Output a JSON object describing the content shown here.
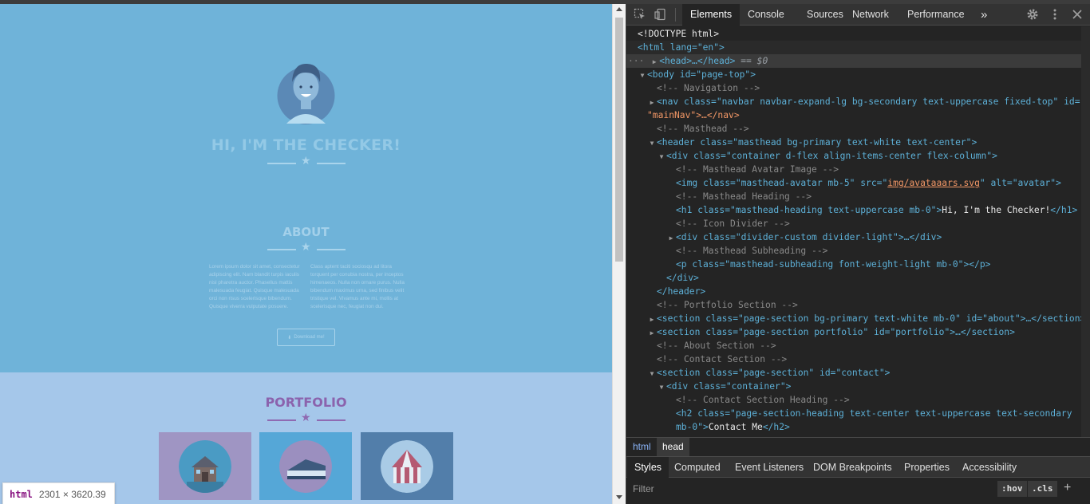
{
  "page": {
    "masthead": {
      "title": "HI, I'M THE CHECKER!"
    },
    "about": {
      "title": "ABOUT",
      "col1": "Lorem ipsum dolor sit amet, consectetur adipiscing elit. Nam blandit turpis iaculis nisl pharetra auctor. Phasellus mattis malesuada feugiat. Quisque malesuada orci non risus scelerisque bibendum. Quisque viverra vulputate posuere.",
      "col2": "Class aptent taciti sociosqu ad litora torquent per conubia nostra, per inceptos himenaeos. Nulla non ornare purus. Nulla bibendum maximus urna, sed finibus velit tristique vel. Vivamus ante mi, mollis at scelerisque nec, feugiat non dui.",
      "download_label": "Download me!"
    },
    "portfolio": {
      "title": "PORTFOLIO"
    },
    "inspect_badge": {
      "tag": "html",
      "dims": "2301 × 3620.39"
    }
  },
  "devtools": {
    "tabs": [
      "Elements",
      "Console",
      "Sources",
      "Network",
      "Performance"
    ],
    "more": "»",
    "elements": {
      "doctype": "<!DOCTYPE html>",
      "html_tag": "<html lang=\"en\">",
      "head": "<head>…</head>",
      "sel_marker": "== $0",
      "body": "<body id=\"page-top\">",
      "c_nav": "<!-- Navigation -->",
      "nav_tag": "<nav class=\"navbar navbar-expand-lg bg-secondary text-uppercase fixed-top\" id=",
      "nav_tag2": "\"mainNav\">…</nav>",
      "c_masthead": "<!-- Masthead -->",
      "header_tag": "<header class=\"masthead bg-primary text-white text-center\">",
      "div_container": "<div class=\"container d-flex align-items-center flex-column\">",
      "c_avatar": "<!-- Masthead Avatar Image -->",
      "img_pre": "<img class=\"masthead-avatar mb-5\" src=\"",
      "img_src": "img/avataaars.svg",
      "img_post": "\" alt=\"avatar\">",
      "c_heading": "<!-- Masthead Heading -->",
      "h1_open": "<h1 class=\"masthead-heading text-uppercase mb-0\">",
      "h1_text": "Hi, I'm the Checker!",
      "h1_close": "</h1>",
      "c_icon": "<!-- Icon Divider -->",
      "div_divider": "<div class=\"divider-custom divider-light\">…</div>",
      "c_sub": "<!-- Masthead Subheading -->",
      "p_tag": "<p class=\"masthead-subheading font-weight-light mb-0\"></p>",
      "div_close": "</div>",
      "header_close": "</header>",
      "c_portfolio": "<!-- Portfolio Section -->",
      "sec_about": "<section class=\"page-section bg-primary text-white mb-0\" id=\"about\">…</section>",
      "sec_portfolio": "<section class=\"page-section portfolio\" id=\"portfolio\">…</section>",
      "c_about": "<!-- About Section -->",
      "c_contact": "<!-- Contact Section -->",
      "sec_contact": "<section class=\"page-section\" id=\"contact\">",
      "div_cont2": "<div class=\"container\">",
      "c_contact_heading": "<!-- Contact Section Heading -->",
      "h2_open": "<h2 class=\"page-section-heading text-center text-uppercase text-secondary",
      "h2_open2": "mb-0\">",
      "h2_text": "Contact Me",
      "h2_close": "</h2>"
    },
    "breadcrumbs": [
      "html",
      "head"
    ],
    "subtabs": [
      "Styles",
      "Computed",
      "Event Listeners",
      "DOM Breakpoints",
      "Properties",
      "Accessibility"
    ],
    "filter": {
      "placeholder": "Filter",
      "hov": ":hov",
      "cls": ".cls",
      "add": "+"
    }
  },
  "colors": {
    "masthead_bg": "#6fb3d9",
    "portfolio_bg": "#a5c7ea",
    "accent_purple": "#8b63ad",
    "devtools_bg": "#242424"
  }
}
